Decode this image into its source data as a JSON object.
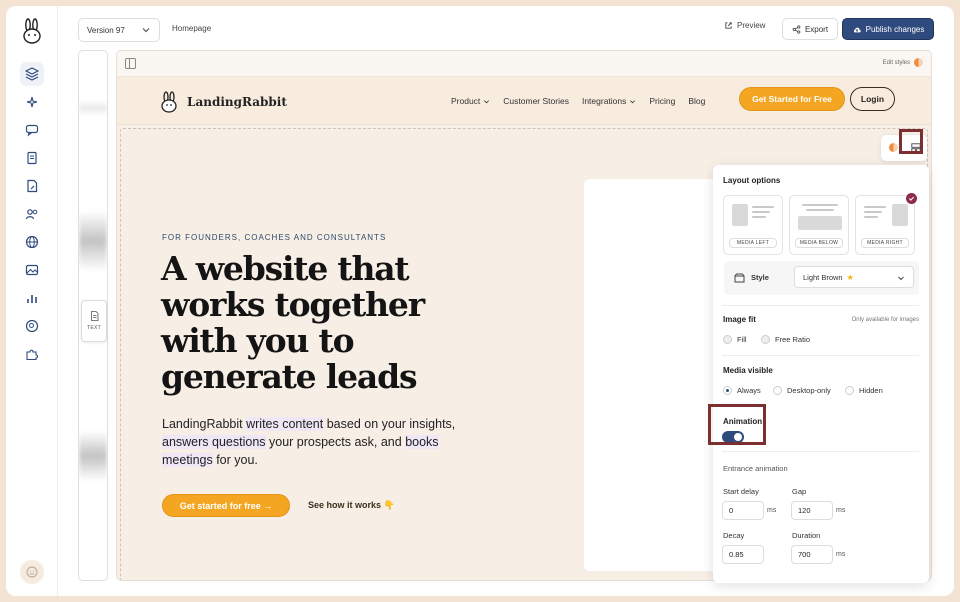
{
  "topbar": {
    "version_label": "Version 97",
    "breadcrumb": "Homepage",
    "preview_label": "Preview",
    "export_label": "Export",
    "publish_label": "Publish changes"
  },
  "side_chip": {
    "label": "TEXT"
  },
  "canvas": {
    "edit_styles_label": "Edit styles"
  },
  "site": {
    "brand": "LandingRabbit",
    "nav": [
      "Product",
      "Customer Stories",
      "Integrations",
      "Pricing",
      "Blog"
    ],
    "cta": "Get Started for Free",
    "login": "Login",
    "eyebrow": "FOR FOUNDERS, COACHES AND CONSULTANTS",
    "headline": "A website that works together with you to generate leads",
    "sub_parts": [
      "LandingRabbit ",
      "writes content",
      " based on your insights, ",
      "answers questions",
      " your prospects ask, and ",
      "books meetings",
      " for you."
    ],
    "hero_cta": "Get started for free →",
    "see_how": "See how it works 👇"
  },
  "panel": {
    "layout_title": "Layout options",
    "options": [
      "MEDIA LEFT",
      "MEDIA BELOW",
      "MEDIA RIGHT"
    ],
    "selected_option": "MEDIA RIGHT",
    "style_label": "Style",
    "style_value": "Light Brown",
    "image_fit_title": "Image fit",
    "image_fit_note": "Only available for images",
    "image_fit_options": [
      "Fill",
      "Free Ratio"
    ],
    "media_visible_title": "Media visible",
    "media_visible_options": [
      "Always",
      "Desktop-only",
      "Hidden"
    ],
    "media_visible_selected": "Always",
    "animation_title": "Animation",
    "animation_on": true,
    "entrance_title": "Entrance animation",
    "start_delay_label": "Start delay",
    "start_delay_value": "0",
    "gap_label": "Gap",
    "gap_value": "120",
    "decay_label": "Decay",
    "decay_value": "0.85",
    "duration_label": "Duration",
    "duration_value": "700",
    "unit_ms": "ms"
  },
  "colors": {
    "accent": "#f4a623",
    "primary": "#2f4a7d",
    "highlight": "#7b2f2f",
    "check": "#8f2a50"
  }
}
